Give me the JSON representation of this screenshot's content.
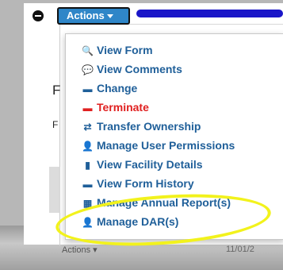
{
  "toolbar": {
    "actions_label": "Actions"
  },
  "page_letters": [
    "F",
    "F"
  ],
  "menu": {
    "items": [
      {
        "label": "View Form",
        "icon": "search-icon",
        "glyph": "🔍",
        "danger": false
      },
      {
        "label": "View Comments",
        "icon": "comments-icon",
        "glyph": "💬",
        "danger": false
      },
      {
        "label": "Change",
        "icon": "file-icon",
        "glyph": "▬",
        "danger": false
      },
      {
        "label": "Terminate",
        "icon": "file-icon",
        "glyph": "▬",
        "danger": true
      },
      {
        "label": "Transfer Ownership",
        "icon": "transfer-icon",
        "glyph": "⇄",
        "danger": false
      },
      {
        "label": "Manage User Permissions",
        "icon": "user-add-icon",
        "glyph": "👤",
        "danger": false
      },
      {
        "label": "View Facility Details",
        "icon": "book-icon",
        "glyph": "▮",
        "danger": false
      },
      {
        "label": "View Form History",
        "icon": "file-history-icon",
        "glyph": "▬",
        "danger": false
      },
      {
        "label": "Manage Annual Report(s)",
        "icon": "calendar-icon",
        "glyph": "▦",
        "danger": false
      },
      {
        "label": "Manage DAR(s)",
        "icon": "user-add-icon",
        "glyph": "👤",
        "danger": false
      }
    ]
  },
  "footer": {
    "actions_label": "Actions",
    "date_fragment": "11/01/2"
  },
  "colors": {
    "link": "#1f5f99",
    "danger": "#e02020",
    "button": "#2f86c8",
    "highlight": "#f2f21c"
  }
}
